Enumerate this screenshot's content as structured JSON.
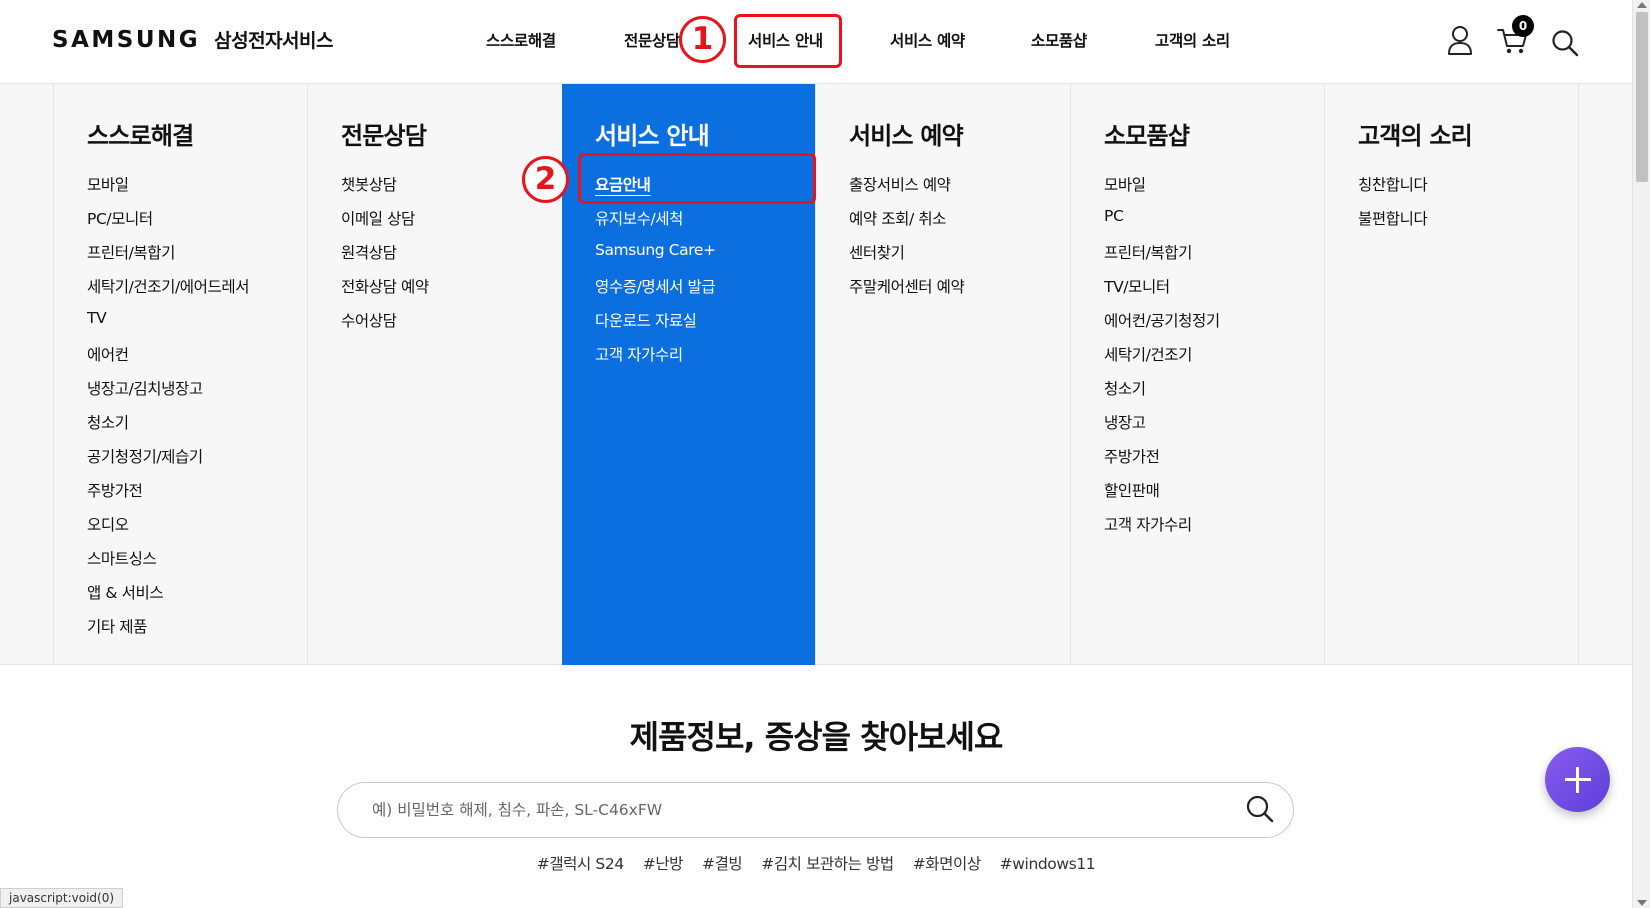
{
  "header": {
    "brand": "SAMSUNG",
    "brand_sub": "삼성전자서비스",
    "nav": [
      "스스로해결",
      "전문상담",
      "서비스 안내",
      "서비스 예약",
      "소모품샵",
      "고객의 소리"
    ],
    "cart_count": "0",
    "icons": {
      "user": "user-icon",
      "cart": "cart-icon",
      "search": "search-icon"
    }
  },
  "annotations": {
    "step1": "1",
    "step2": "2",
    "color": "#e8141c"
  },
  "mega_menu": {
    "active_color": "#0b6fe0",
    "columns": [
      {
        "title": "스스로해결",
        "items": [
          "모바일",
          "PC/모니터",
          "프린터/복합기",
          "세탁기/건조기/에어드레서",
          "TV",
          "에어컨",
          "냉장고/김치냉장고",
          "청소기",
          "공기청정기/제습기",
          "주방가전",
          "오디오",
          "스마트싱스",
          "앱 & 서비스",
          "기타 제품"
        ]
      },
      {
        "title": "전문상담",
        "items": [
          "챗봇상담",
          "이메일 상담",
          "원격상담",
          "전화상담 예약",
          "수어상담"
        ]
      },
      {
        "title": "서비스 안내",
        "items": [
          "요금안내",
          "유지보수/세척",
          "Samsung Care+",
          "영수증/명세서 발급",
          "다운로드 자료실",
          "고객 자가수리"
        ]
      },
      {
        "title": "서비스 예약",
        "items": [
          "출장서비스 예약",
          "예약 조회/ 취소",
          "센터찾기",
          "주말케어센터 예약"
        ]
      },
      {
        "title": "소모품샵",
        "items": [
          "모바일",
          "PC",
          "프린터/복합기",
          "TV/모니터",
          "에어컨/공기청정기",
          "세탁기/건조기",
          "청소기",
          "냉장고",
          "주방가전",
          "할인판매",
          "고객 자가수리"
        ]
      },
      {
        "title": "고객의 소리",
        "items": [
          "칭찬합니다",
          "불편합니다"
        ]
      }
    ]
  },
  "search": {
    "title": "제품정보, 증상을 찾아보세요",
    "placeholder": "예) 비밀번호 해제, 침수, 파손, SL-C46xFW",
    "tags": [
      "#갤럭시 S24",
      "#난방",
      "#결빙",
      "#김치 보관하는 방법",
      "#화면이상",
      "#windows11"
    ]
  },
  "status_bar": "javascript:void(0)"
}
